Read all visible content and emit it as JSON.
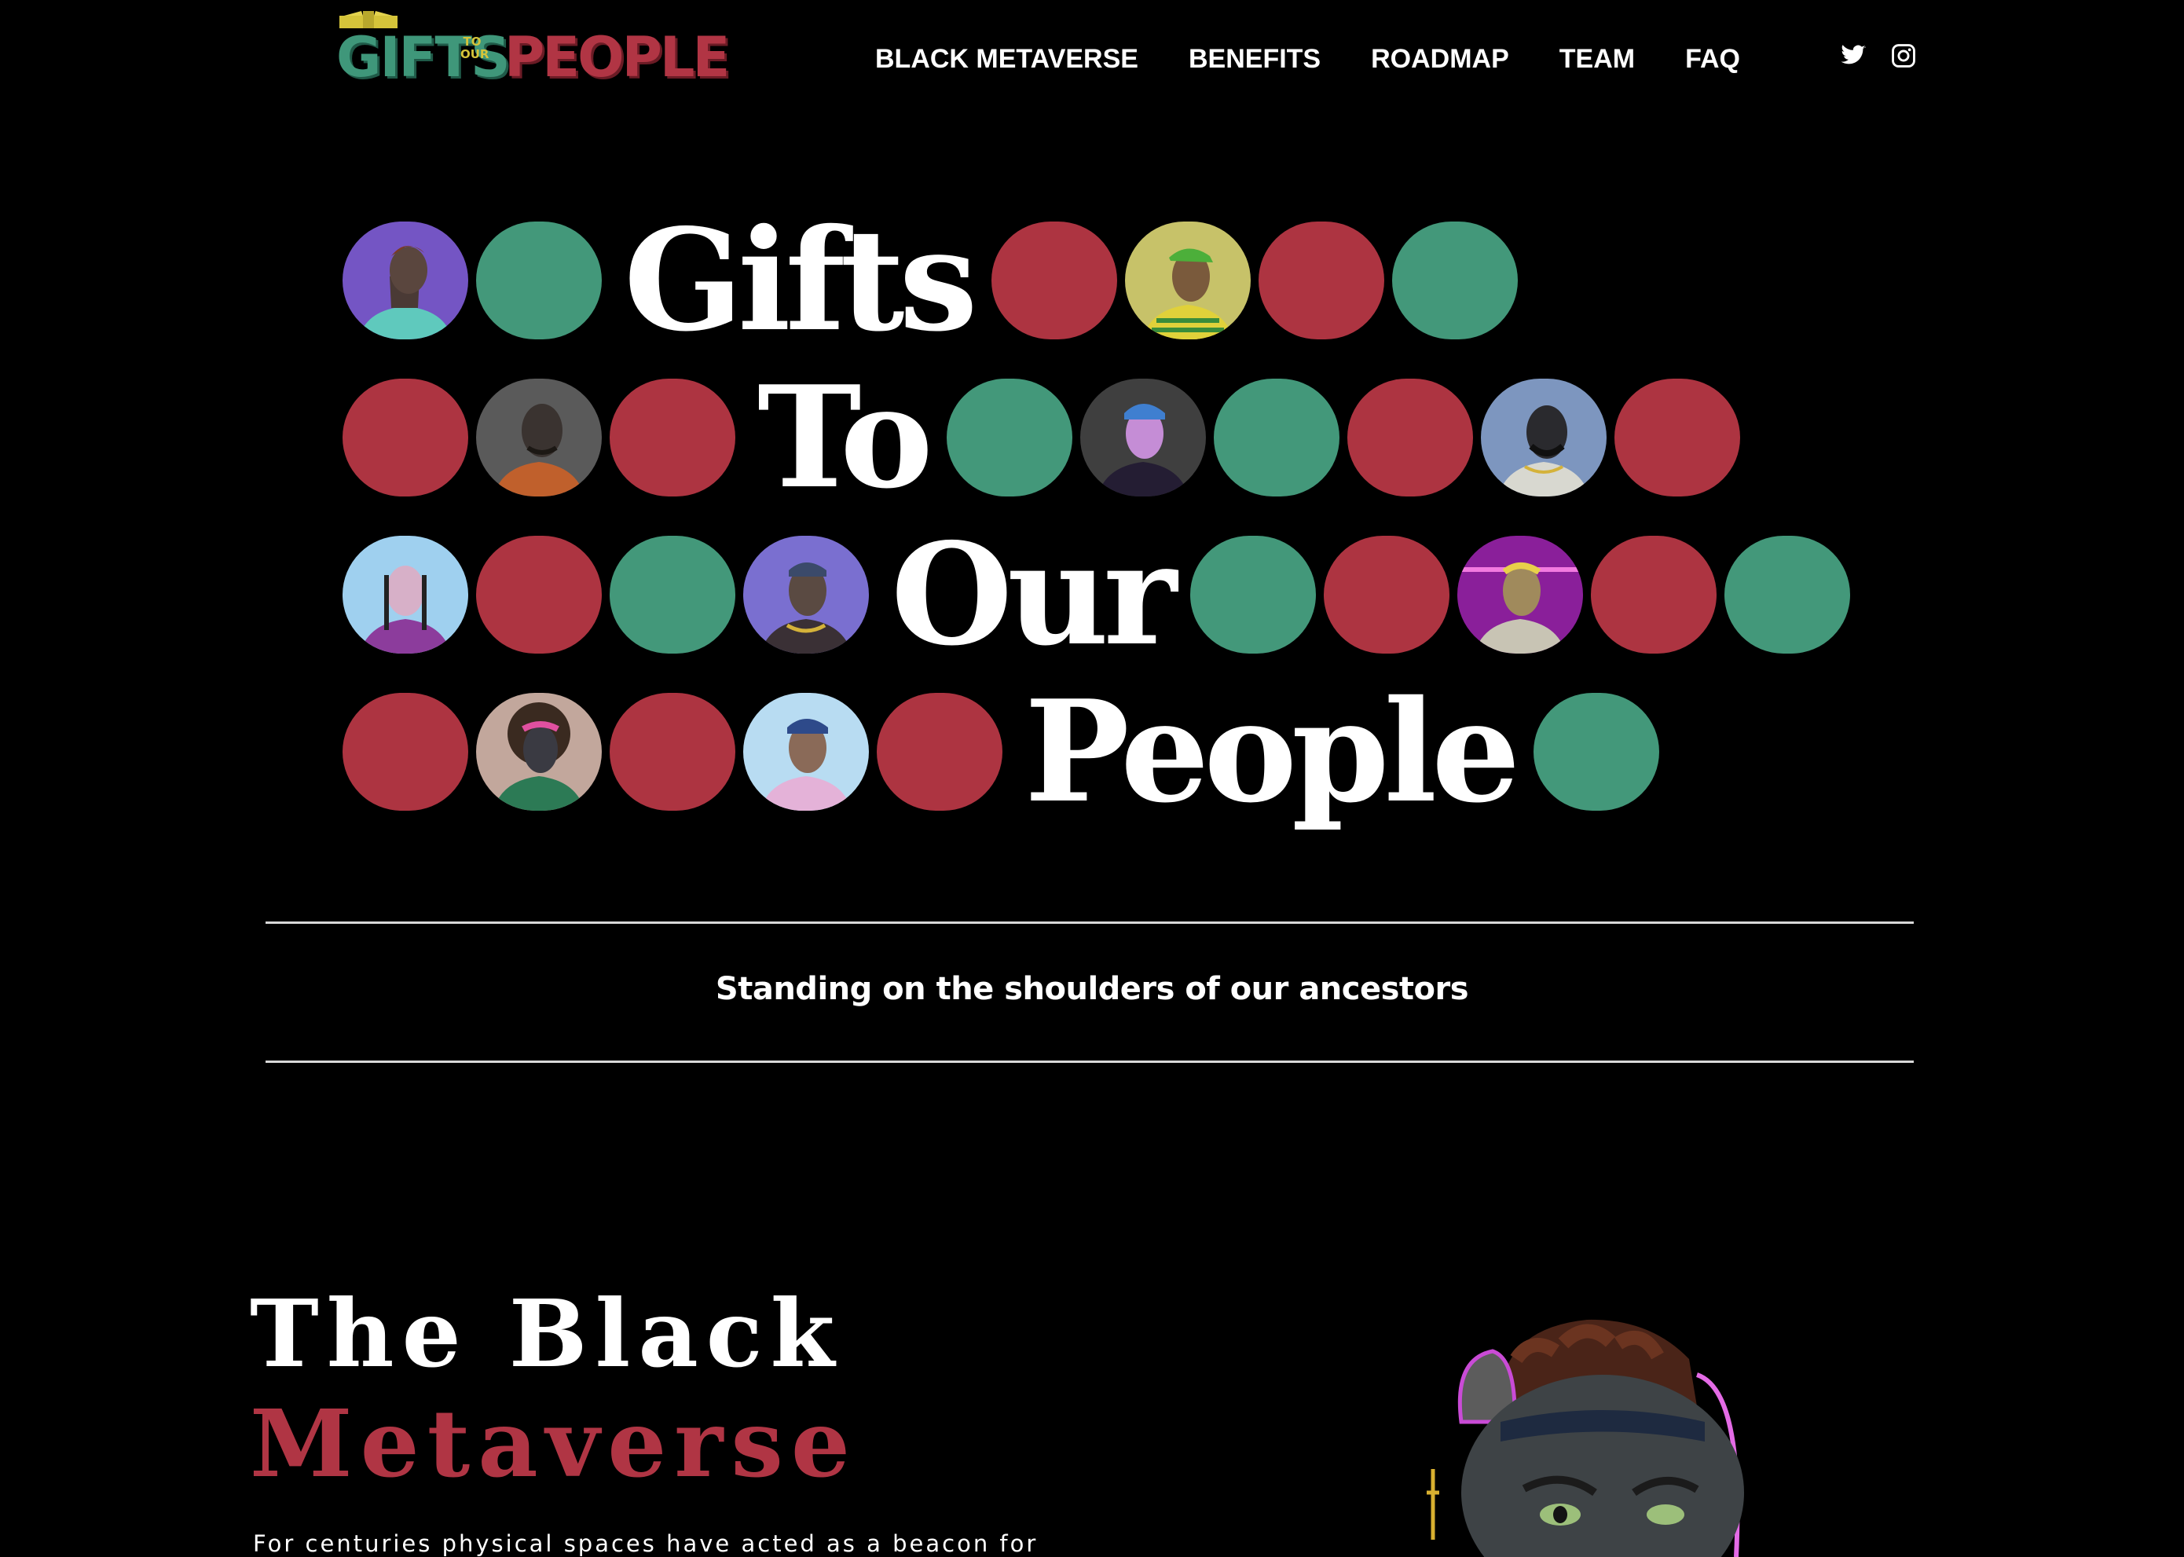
{
  "logo": {
    "line1": "GIFTS",
    "connector": "TO OUR",
    "line2": "PEOPLE",
    "alt": "Gifts to Our People logo"
  },
  "nav": {
    "items": [
      {
        "label": "BLACK METAVERSE"
      },
      {
        "label": "BENEFITS"
      },
      {
        "label": "ROADMAP"
      },
      {
        "label": "TEAM"
      },
      {
        "label": "FAQ"
      }
    ]
  },
  "social": {
    "icons": [
      "twitter-icon",
      "instagram-icon"
    ]
  },
  "hero": {
    "words": [
      "Gifts",
      "To",
      "Our",
      "People"
    ],
    "colors": {
      "green": "#43987a",
      "red": "#ad3441",
      "background": "#000000"
    }
  },
  "tagline": "Standing on the shoulders of our ancestors",
  "section": {
    "title_line1": "The Black",
    "title_line2": "Metaverse",
    "title_accent": "#b03544",
    "text": "For centuries physical spaces have acted as a beacon for"
  }
}
